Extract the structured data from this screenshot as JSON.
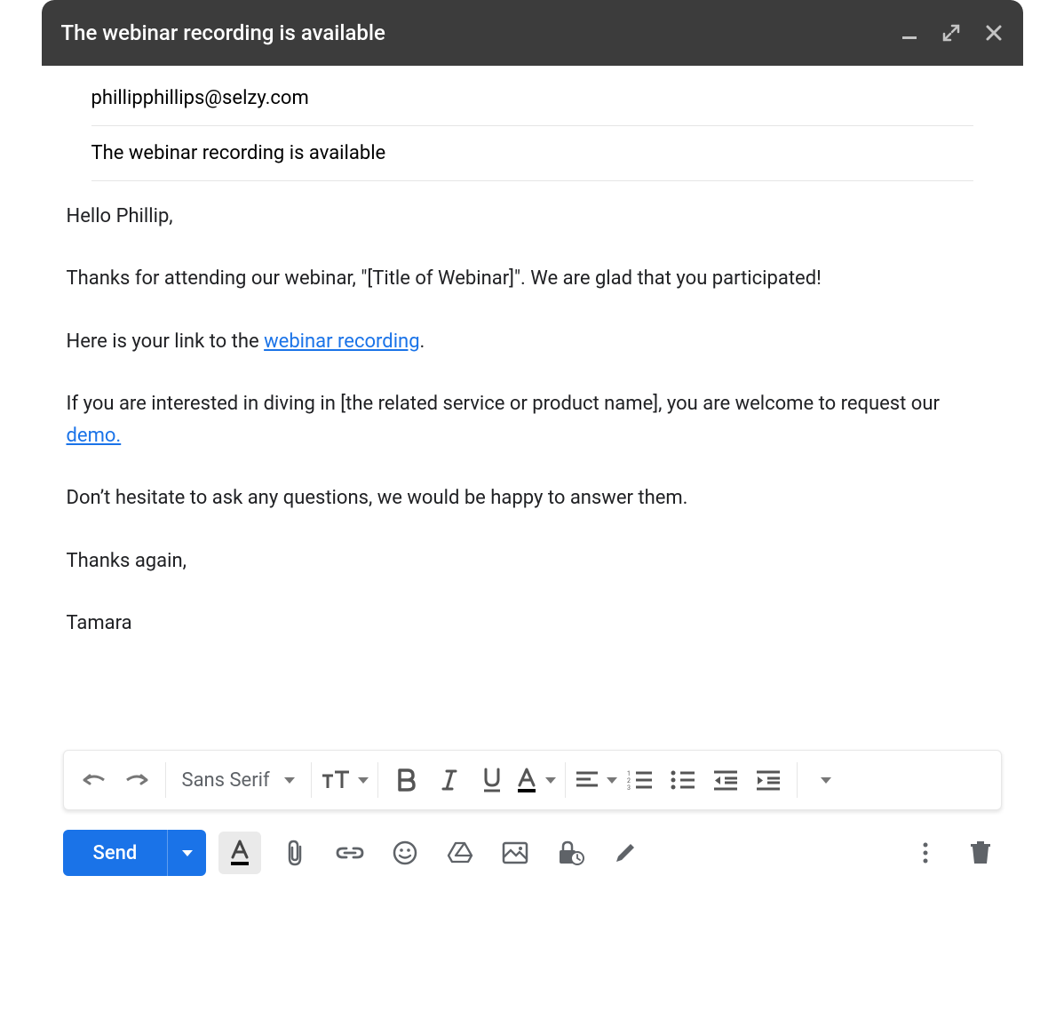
{
  "window": {
    "title": "The webinar recording is available"
  },
  "to_field": "phillipphillips@selzy.com",
  "subject_field": "The webinar recording is available",
  "body": {
    "greeting": "Hello Phillip,",
    "p1": "Thanks for attending our webinar, \"[Title of Webinar]\". We are glad that you participated!",
    "p2_pre": "Here is your link to the ",
    "p2_link": "webinar recording",
    "p2_post": ".",
    "p3_pre": "If you are interested in diving in [the related service or product name], you are welcome to request our ",
    "p3_link": "demo.",
    "p4": "Don’t hesitate to ask any questions, we would be happy to answer them.",
    "p5": "Thanks again,",
    "signature": "Tamara"
  },
  "format": {
    "font_family": "Sans Serif"
  },
  "actions": {
    "send_label": "Send"
  }
}
